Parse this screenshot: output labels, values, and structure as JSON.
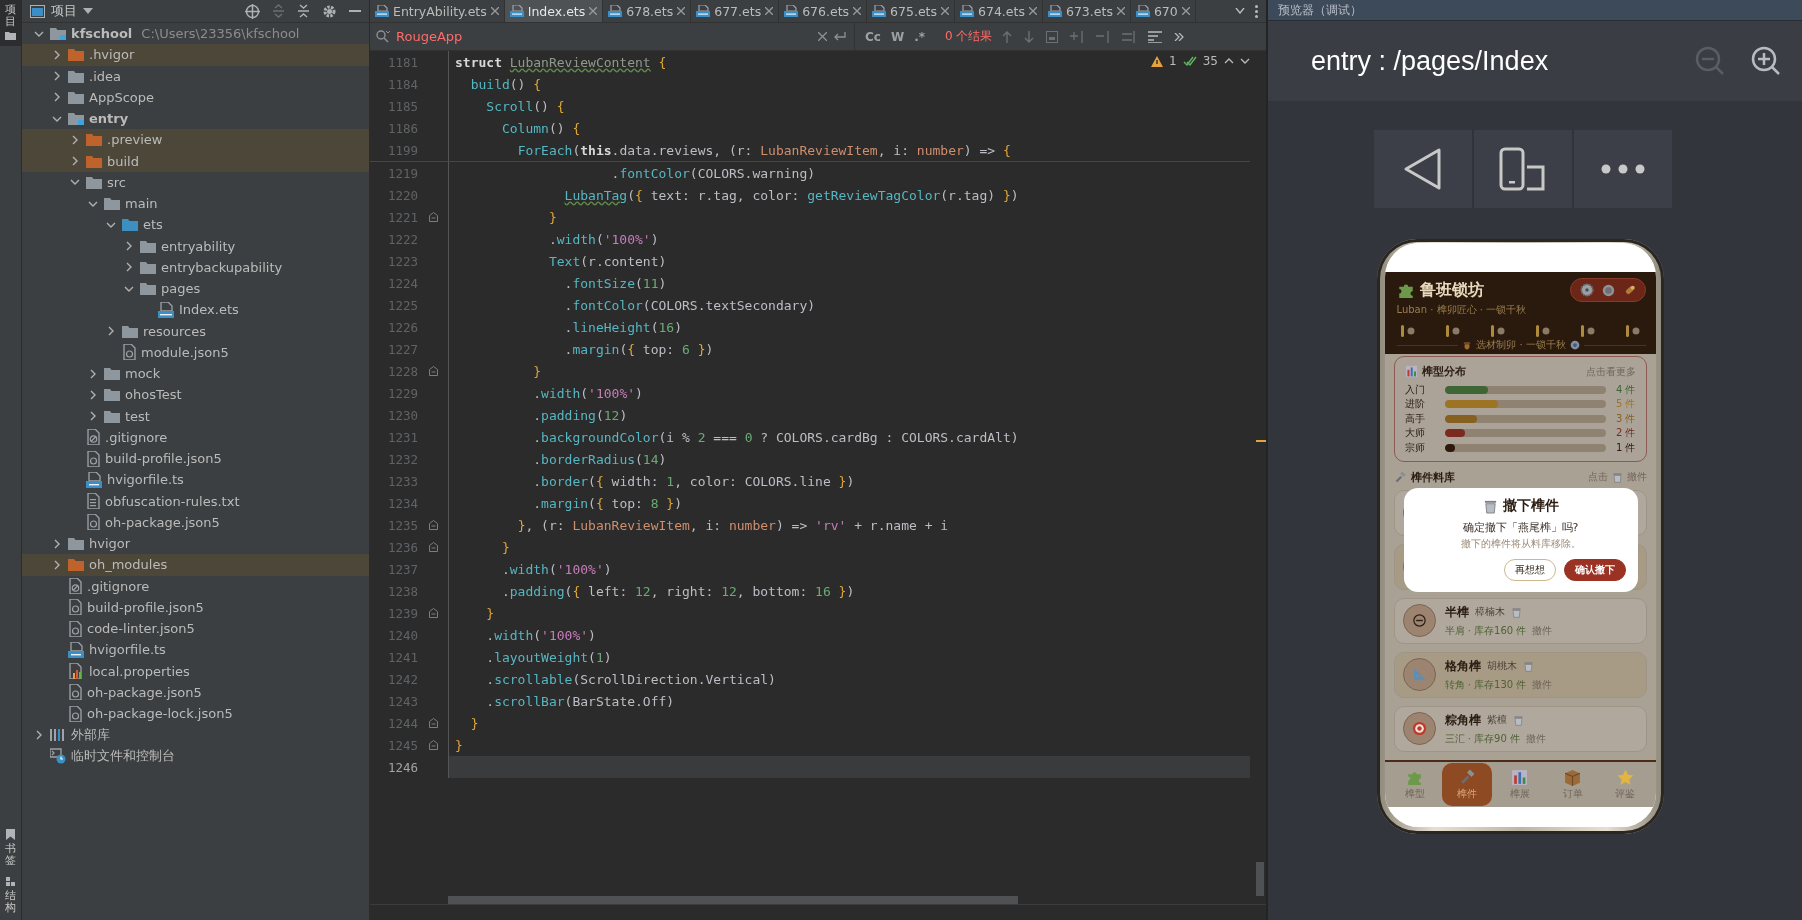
{
  "tool_strip": {
    "top": [
      {
        "kind": "project",
        "label": "项目",
        "selected": true
      }
    ],
    "bottom": [
      {
        "kind": "bookmarks",
        "label": "书签",
        "selected": false
      },
      {
        "kind": "structure",
        "label": "结构",
        "selected": false
      }
    ]
  },
  "project": {
    "title": "项目",
    "tree": [
      {
        "name": "kfschool",
        "path": "C:\\Users\\23356\\kfschool",
        "kind": "module",
        "expanded": true,
        "children": [
          {
            "name": ".hvigor",
            "kind": "excluded_folder",
            "expanded": false
          },
          {
            "name": ".idea",
            "kind": "folder",
            "expanded": false
          },
          {
            "name": "AppScope",
            "kind": "folder",
            "expanded": false
          },
          {
            "name": "entry",
            "kind": "module",
            "expanded": true,
            "children": [
              {
                "name": ".preview",
                "kind": "excluded_folder",
                "expanded": false
              },
              {
                "name": "build",
                "kind": "excluded_folder",
                "expanded": false
              },
              {
                "name": "src",
                "kind": "folder",
                "expanded": true,
                "children": [
                  {
                    "name": "main",
                    "kind": "folder",
                    "expanded": true,
                    "children": [
                      {
                        "name": "ets",
                        "kind": "source_folder",
                        "expanded": true,
                        "children": [
                          {
                            "name": "entryability",
                            "kind": "folder",
                            "expanded": false
                          },
                          {
                            "name": "entrybackupability",
                            "kind": "folder",
                            "expanded": false
                          },
                          {
                            "name": "pages",
                            "kind": "folder",
                            "expanded": true,
                            "children": [
                              {
                                "name": "Index.ets",
                                "kind": "ets"
                              }
                            ]
                          }
                        ]
                      },
                      {
                        "name": "resources",
                        "kind": "folder",
                        "expanded": false
                      },
                      {
                        "name": "module.json5",
                        "kind": "json5"
                      }
                    ]
                  },
                  {
                    "name": "mock",
                    "kind": "folder",
                    "expanded": false
                  },
                  {
                    "name": "ohosTest",
                    "kind": "folder",
                    "expanded": false
                  },
                  {
                    "name": "test",
                    "kind": "folder",
                    "expanded": false
                  }
                ]
              },
              {
                "name": ".gitignore",
                "kind": "ignore"
              },
              {
                "name": "build-profile.json5",
                "kind": "json5"
              },
              {
                "name": "hvigorfile.ts",
                "kind": "ts"
              },
              {
                "name": "obfuscation-rules.txt",
                "kind": "txt"
              },
              {
                "name": "oh-package.json5",
                "kind": "json5"
              }
            ]
          },
          {
            "name": "hvigor",
            "kind": "folder",
            "expanded": false
          },
          {
            "name": "oh_modules",
            "kind": "excluded_folder",
            "expanded": false
          },
          {
            "name": ".gitignore",
            "kind": "ignore"
          },
          {
            "name": "build-profile.json5",
            "kind": "json5"
          },
          {
            "name": "code-linter.json5",
            "kind": "json5"
          },
          {
            "name": "hvigorfile.ts",
            "kind": "ts"
          },
          {
            "name": "local.properties",
            "kind": "properties"
          },
          {
            "name": "oh-package.json5",
            "kind": "json5"
          },
          {
            "name": "oh-package-lock.json5",
            "kind": "json5"
          }
        ]
      },
      {
        "name": "外部库",
        "kind": "library",
        "expanded": false
      },
      {
        "name": "临时文件和控制台",
        "kind": "scratch"
      }
    ]
  },
  "editor": {
    "tabs": [
      {
        "label": "EntryAbility.ets",
        "selected": false
      },
      {
        "label": "Index.ets",
        "selected": true
      },
      {
        "label": "678.ets",
        "selected": false
      },
      {
        "label": "677.ets",
        "selected": false
      },
      {
        "label": "676.ets",
        "selected": false
      },
      {
        "label": "675.ets",
        "selected": false
      },
      {
        "label": "674.ets",
        "selected": false
      },
      {
        "label": "673.ets",
        "selected": false
      },
      {
        "label": "670",
        "selected": false
      }
    ],
    "search": {
      "value": "RougeApp",
      "toggles": [
        "Cc",
        "W",
        ".*"
      ],
      "result": "0 个结果"
    },
    "inspection": {
      "warnings": "1",
      "passed": "35"
    },
    "sticky_lines": [
      {
        "number": "1181",
        "tokens": [
          {
            "text": "struct ",
            "kind": "keyword"
          },
          {
            "text": "LubanReviewContent",
            "kind": "class"
          },
          {
            "text": " {",
            "kind": "brace"
          }
        ]
      },
      {
        "number": "1184",
        "tokens": [
          {
            "text": "  build",
            "kind": "call"
          },
          {
            "text": "() ",
            "kind": "plain"
          },
          {
            "text": "{",
            "kind": "brace"
          }
        ]
      },
      {
        "number": "1185",
        "tokens": [
          {
            "text": "    Scroll",
            "kind": "call"
          },
          {
            "text": "() ",
            "kind": "plain"
          },
          {
            "text": "{",
            "kind": "brace"
          }
        ]
      },
      {
        "number": "1186",
        "tokens": [
          {
            "text": "      Column",
            "kind": "call"
          },
          {
            "text": "() ",
            "kind": "plain"
          },
          {
            "text": "{",
            "kind": "brace"
          }
        ]
      },
      {
        "number": "1199",
        "tokens": [
          {
            "text": "        ForEach",
            "kind": "call"
          },
          {
            "text": "(",
            "kind": "plain"
          },
          {
            "text": "this",
            "kind": "keyword"
          },
          {
            "text": ".data.reviews, (r: ",
            "kind": "plain"
          },
          {
            "text": "LubanReviewItem",
            "kind": "type"
          },
          {
            "text": ", i: ",
            "kind": "plain"
          },
          {
            "text": "number",
            "kind": "type"
          },
          {
            "text": ") => ",
            "kind": "plain"
          },
          {
            "text": "{",
            "kind": "brace"
          }
        ]
      }
    ],
    "lines": [
      {
        "number": "1219",
        "fold": false,
        "current": false,
        "tokens": [
          {
            "text": "                    .",
            "kind": "plain"
          },
          {
            "text": "fontColor",
            "kind": "call"
          },
          {
            "text": "(COLORS.warning)",
            "kind": "plain"
          }
        ]
      },
      {
        "number": "1220",
        "fold": false,
        "current": false,
        "tokens": [
          {
            "text": "              LubanTag",
            "kind": "component"
          },
          {
            "text": "(",
            "kind": "plain"
          },
          {
            "text": "{",
            "kind": "brace"
          },
          {
            "text": " text: r.tag, color: ",
            "kind": "plain"
          },
          {
            "text": "getReviewTagColor",
            "kind": "call"
          },
          {
            "text": "(r.tag) ",
            "kind": "plain"
          },
          {
            "text": "}",
            "kind": "brace"
          },
          {
            "text": ")",
            "kind": "plain"
          }
        ]
      },
      {
        "number": "1221",
        "fold": true,
        "current": false,
        "tokens": [
          {
            "text": "            }",
            "kind": "brace"
          }
        ]
      },
      {
        "number": "1222",
        "fold": false,
        "current": false,
        "tokens": [
          {
            "text": "            .",
            "kind": "plain"
          },
          {
            "text": "width",
            "kind": "call"
          },
          {
            "text": "(",
            "kind": "plain"
          },
          {
            "text": "'100%'",
            "kind": "string"
          },
          {
            "text": ")",
            "kind": "plain"
          }
        ]
      },
      {
        "number": "1223",
        "fold": false,
        "current": false,
        "tokens": [
          {
            "text": "            Text",
            "kind": "call"
          },
          {
            "text": "(r.content)",
            "kind": "plain"
          }
        ]
      },
      {
        "number": "1224",
        "fold": false,
        "current": false,
        "tokens": [
          {
            "text": "              .",
            "kind": "plain"
          },
          {
            "text": "fontSize",
            "kind": "call"
          },
          {
            "text": "(",
            "kind": "plain"
          },
          {
            "text": "11",
            "kind": "number"
          },
          {
            "text": ")",
            "kind": "plain"
          }
        ]
      },
      {
        "number": "1225",
        "fold": false,
        "current": false,
        "tokens": [
          {
            "text": "              .",
            "kind": "plain"
          },
          {
            "text": "fontColor",
            "kind": "call"
          },
          {
            "text": "(COLORS.textSecondary)",
            "kind": "plain"
          }
        ]
      },
      {
        "number": "1226",
        "fold": false,
        "current": false,
        "tokens": [
          {
            "text": "              .",
            "kind": "plain"
          },
          {
            "text": "lineHeight",
            "kind": "call"
          },
          {
            "text": "(",
            "kind": "plain"
          },
          {
            "text": "16",
            "kind": "number"
          },
          {
            "text": ")",
            "kind": "plain"
          }
        ]
      },
      {
        "number": "1227",
        "fold": false,
        "current": false,
        "tokens": [
          {
            "text": "              .",
            "kind": "plain"
          },
          {
            "text": "margin",
            "kind": "call"
          },
          {
            "text": "(",
            "kind": "plain"
          },
          {
            "text": "{",
            "kind": "brace"
          },
          {
            "text": " top: ",
            "kind": "plain"
          },
          {
            "text": "6",
            "kind": "number"
          },
          {
            "text": " }",
            "kind": "brace"
          },
          {
            "text": ")",
            "kind": "plain"
          }
        ]
      },
      {
        "number": "1228",
        "fold": true,
        "current": false,
        "tokens": [
          {
            "text": "          }",
            "kind": "brace"
          }
        ]
      },
      {
        "number": "1229",
        "fold": false,
        "current": false,
        "tokens": [
          {
            "text": "          .",
            "kind": "plain"
          },
          {
            "text": "width",
            "kind": "call"
          },
          {
            "text": "(",
            "kind": "plain"
          },
          {
            "text": "'100%'",
            "kind": "string"
          },
          {
            "text": ")",
            "kind": "plain"
          }
        ]
      },
      {
        "number": "1230",
        "fold": false,
        "current": false,
        "tokens": [
          {
            "text": "          .",
            "kind": "plain"
          },
          {
            "text": "padding",
            "kind": "call"
          },
          {
            "text": "(",
            "kind": "plain"
          },
          {
            "text": "12",
            "kind": "number"
          },
          {
            "text": ")",
            "kind": "plain"
          }
        ]
      },
      {
        "number": "1231",
        "fold": false,
        "current": false,
        "tokens": [
          {
            "text": "          .",
            "kind": "plain"
          },
          {
            "text": "backgroundColor",
            "kind": "call"
          },
          {
            "text": "(i % ",
            "kind": "plain"
          },
          {
            "text": "2",
            "kind": "number"
          },
          {
            "text": " === ",
            "kind": "plain"
          },
          {
            "text": "0",
            "kind": "number"
          },
          {
            "text": " ? COLORS.cardBg : COLORS.cardAlt)",
            "kind": "plain"
          }
        ]
      },
      {
        "number": "1232",
        "fold": false,
        "current": false,
        "tokens": [
          {
            "text": "          .",
            "kind": "plain"
          },
          {
            "text": "borderRadius",
            "kind": "call"
          },
          {
            "text": "(",
            "kind": "plain"
          },
          {
            "text": "14",
            "kind": "number"
          },
          {
            "text": ")",
            "kind": "plain"
          }
        ]
      },
      {
        "number": "1233",
        "fold": false,
        "current": false,
        "tokens": [
          {
            "text": "          .",
            "kind": "plain"
          },
          {
            "text": "border",
            "kind": "call"
          },
          {
            "text": "(",
            "kind": "plain"
          },
          {
            "text": "{",
            "kind": "brace"
          },
          {
            "text": " width: ",
            "kind": "plain"
          },
          {
            "text": "1",
            "kind": "number"
          },
          {
            "text": ", color: COLORS.line ",
            "kind": "plain"
          },
          {
            "text": "}",
            "kind": "brace"
          },
          {
            "text": ")",
            "kind": "plain"
          }
        ]
      },
      {
        "number": "1234",
        "fold": false,
        "current": false,
        "tokens": [
          {
            "text": "          .",
            "kind": "plain"
          },
          {
            "text": "margin",
            "kind": "call"
          },
          {
            "text": "(",
            "kind": "plain"
          },
          {
            "text": "{",
            "kind": "brace"
          },
          {
            "text": " top: ",
            "kind": "plain"
          },
          {
            "text": "8",
            "kind": "number"
          },
          {
            "text": " }",
            "kind": "brace"
          },
          {
            "text": ")",
            "kind": "plain"
          }
        ]
      },
      {
        "number": "1235",
        "fold": true,
        "current": false,
        "tokens": [
          {
            "text": "        }",
            "kind": "brace"
          },
          {
            "text": ", (r: ",
            "kind": "plain"
          },
          {
            "text": "LubanReviewItem",
            "kind": "type"
          },
          {
            "text": ", i: ",
            "kind": "plain"
          },
          {
            "text": "number",
            "kind": "type"
          },
          {
            "text": ") => ",
            "kind": "plain"
          },
          {
            "text": "'rv'",
            "kind": "string"
          },
          {
            "text": " + r.name + i",
            "kind": "plain"
          }
        ]
      },
      {
        "number": "1236",
        "fold": true,
        "current": false,
        "tokens": [
          {
            "text": "      }",
            "kind": "brace"
          }
        ]
      },
      {
        "number": "1237",
        "fold": false,
        "current": false,
        "tokens": [
          {
            "text": "      .",
            "kind": "plain"
          },
          {
            "text": "width",
            "kind": "call"
          },
          {
            "text": "(",
            "kind": "plain"
          },
          {
            "text": "'100%'",
            "kind": "string"
          },
          {
            "text": ")",
            "kind": "plain"
          }
        ]
      },
      {
        "number": "1238",
        "fold": false,
        "current": false,
        "tokens": [
          {
            "text": "      .",
            "kind": "plain"
          },
          {
            "text": "padding",
            "kind": "call"
          },
          {
            "text": "(",
            "kind": "plain"
          },
          {
            "text": "{",
            "kind": "brace"
          },
          {
            "text": " left: ",
            "kind": "plain"
          },
          {
            "text": "12",
            "kind": "number"
          },
          {
            "text": ", right: ",
            "kind": "plain"
          },
          {
            "text": "12",
            "kind": "number"
          },
          {
            "text": ", bottom: ",
            "kind": "plain"
          },
          {
            "text": "16",
            "kind": "number"
          },
          {
            "text": " }",
            "kind": "brace"
          },
          {
            "text": ")",
            "kind": "plain"
          }
        ]
      },
      {
        "number": "1239",
        "fold": true,
        "current": false,
        "tokens": [
          {
            "text": "    }",
            "kind": "brace"
          }
        ]
      },
      {
        "number": "1240",
        "fold": false,
        "current": false,
        "tokens": [
          {
            "text": "    .",
            "kind": "plain"
          },
          {
            "text": "width",
            "kind": "call"
          },
          {
            "text": "(",
            "kind": "plain"
          },
          {
            "text": "'100%'",
            "kind": "string"
          },
          {
            "text": ")",
            "kind": "plain"
          }
        ]
      },
      {
        "number": "1241",
        "fold": false,
        "current": false,
        "tokens": [
          {
            "text": "    .",
            "kind": "plain"
          },
          {
            "text": "layoutWeight",
            "kind": "call"
          },
          {
            "text": "(",
            "kind": "plain"
          },
          {
            "text": "1",
            "kind": "number"
          },
          {
            "text": ")",
            "kind": "plain"
          }
        ]
      },
      {
        "number": "1242",
        "fold": false,
        "current": false,
        "tokens": [
          {
            "text": "    .",
            "kind": "plain"
          },
          {
            "text": "scrollable",
            "kind": "call"
          },
          {
            "text": "(ScrollDirection.Vertical)",
            "kind": "plain"
          }
        ]
      },
      {
        "number": "1243",
        "fold": false,
        "current": false,
        "tokens": [
          {
            "text": "    .",
            "kind": "plain"
          },
          {
            "text": "scrollBar",
            "kind": "call"
          },
          {
            "text": "(BarState.Off)",
            "kind": "plain"
          }
        ]
      },
      {
        "number": "1244",
        "fold": true,
        "current": false,
        "tokens": [
          {
            "text": "  }",
            "kind": "brace"
          }
        ]
      },
      {
        "number": "1245",
        "fold": true,
        "current": false,
        "tokens": [
          {
            "text": "}",
            "kind": "brace"
          }
        ]
      },
      {
        "number": "1246",
        "fold": false,
        "current": true
      }
    ]
  },
  "preview": {
    "title": "预览器（调试）",
    "route": "entry : /pages/Index",
    "app": {
      "title": "鲁班锁坊",
      "subtitle": "Luban · 榫卯匠心 · 一锁千秋",
      "motto": "选材制卯 · 一锁千秋",
      "distribution": {
        "title": "榫型分布",
        "hint": "点击看更多",
        "rows": [
          {
            "label": "入门",
            "count": "4 件",
            "level": 0.27,
            "color": "#3e6634"
          },
          {
            "label": "进阶",
            "count": "5 件",
            "level": 0.33,
            "color": "#9c7424"
          },
          {
            "label": "高手",
            "count": "3 件",
            "level": 0.2,
            "color": "#86601e"
          },
          {
            "label": "大师",
            "count": "2 件",
            "level": 0.13,
            "color": "#7a2a1e"
          },
          {
            "label": "宗师",
            "count": "1 件",
            "level": 0.067,
            "color": "#2e1a0c"
          }
        ]
      },
      "library": {
        "title": "榫件料库",
        "hint_start": "点击",
        "hint_end": "撤件",
        "items": [
          {
            "kind": "half",
            "name": "半榫",
            "wood": "樟楠木",
            "info": "半肩 · 库存160 件",
            "action": "撤件"
          },
          {
            "kind": "corner",
            "name": "格角榫",
            "wood": "胡桃木",
            "info": "转角 · 库存130 件",
            "action": "撤件"
          },
          {
            "kind": "target",
            "name": "粽角榫",
            "wood": "紫檀",
            "info": "三汇 · 库存90 件",
            "action": "撤件"
          }
        ]
      },
      "dialog": {
        "title": "撤下榫件",
        "message": "确定撤下「燕尾榫」吗?",
        "note": "撤下的榫件将从料库移除。",
        "buttons": [
          {
            "label": "再想想",
            "kind": "secondary"
          },
          {
            "label": "确认撤下",
            "kind": "primary"
          }
        ]
      },
      "nav": [
        {
          "kind": "puzzle",
          "label": "榫型",
          "selected": false
        },
        {
          "kind": "hammer",
          "label": "榫件",
          "selected": true
        },
        {
          "kind": "chart",
          "label": "榫展",
          "selected": false
        },
        {
          "kind": "box",
          "label": "订单",
          "selected": false
        },
        {
          "kind": "star",
          "label": "评鉴",
          "selected": false
        }
      ]
    }
  }
}
